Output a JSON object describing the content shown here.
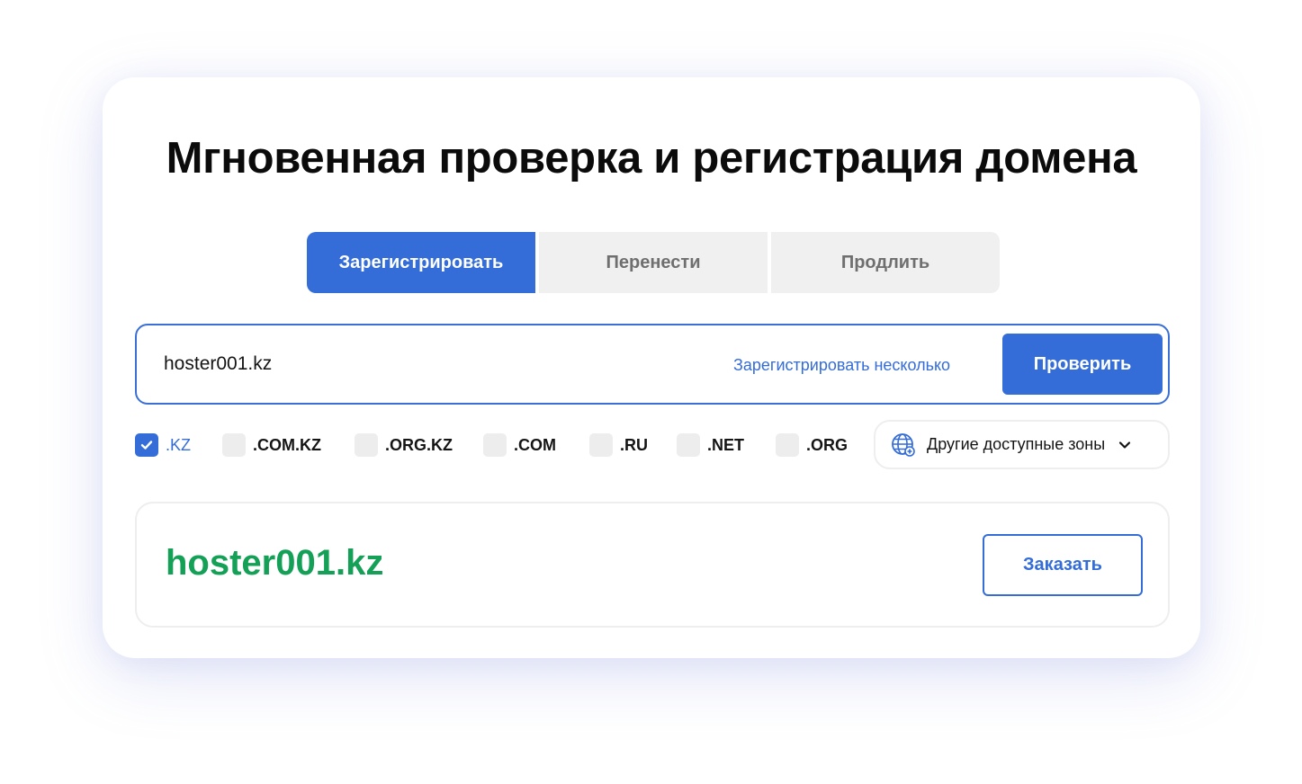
{
  "title": "Мгновенная проверка и регистрация домена",
  "tabs": [
    {
      "label": "Зарегистрировать",
      "active": true
    },
    {
      "label": "Перенести",
      "active": false
    },
    {
      "label": "Продлить",
      "active": false
    }
  ],
  "search": {
    "value": "hoster001.kz",
    "multi_link": "Зарегистрировать несколько",
    "check_label": "Проверить"
  },
  "zones": [
    {
      "label": ".KZ",
      "checked": true
    },
    {
      "label": ".COM.KZ",
      "checked": false
    },
    {
      "label": ".ORG.KZ",
      "checked": false
    },
    {
      "label": ".COM",
      "checked": false
    },
    {
      "label": ".RU",
      "checked": false
    },
    {
      "label": ".NET",
      "checked": false
    },
    {
      "label": ".ORG",
      "checked": false
    }
  ],
  "other_zones": {
    "label": "Другие доступные зоны",
    "icon": "globe-icon"
  },
  "result": {
    "domain": "hoster001.kz",
    "order_label": "Заказать"
  },
  "colors": {
    "accent": "#346cd8",
    "available": "#14a056",
    "tab_inactive_bg": "#f0f0f0"
  }
}
